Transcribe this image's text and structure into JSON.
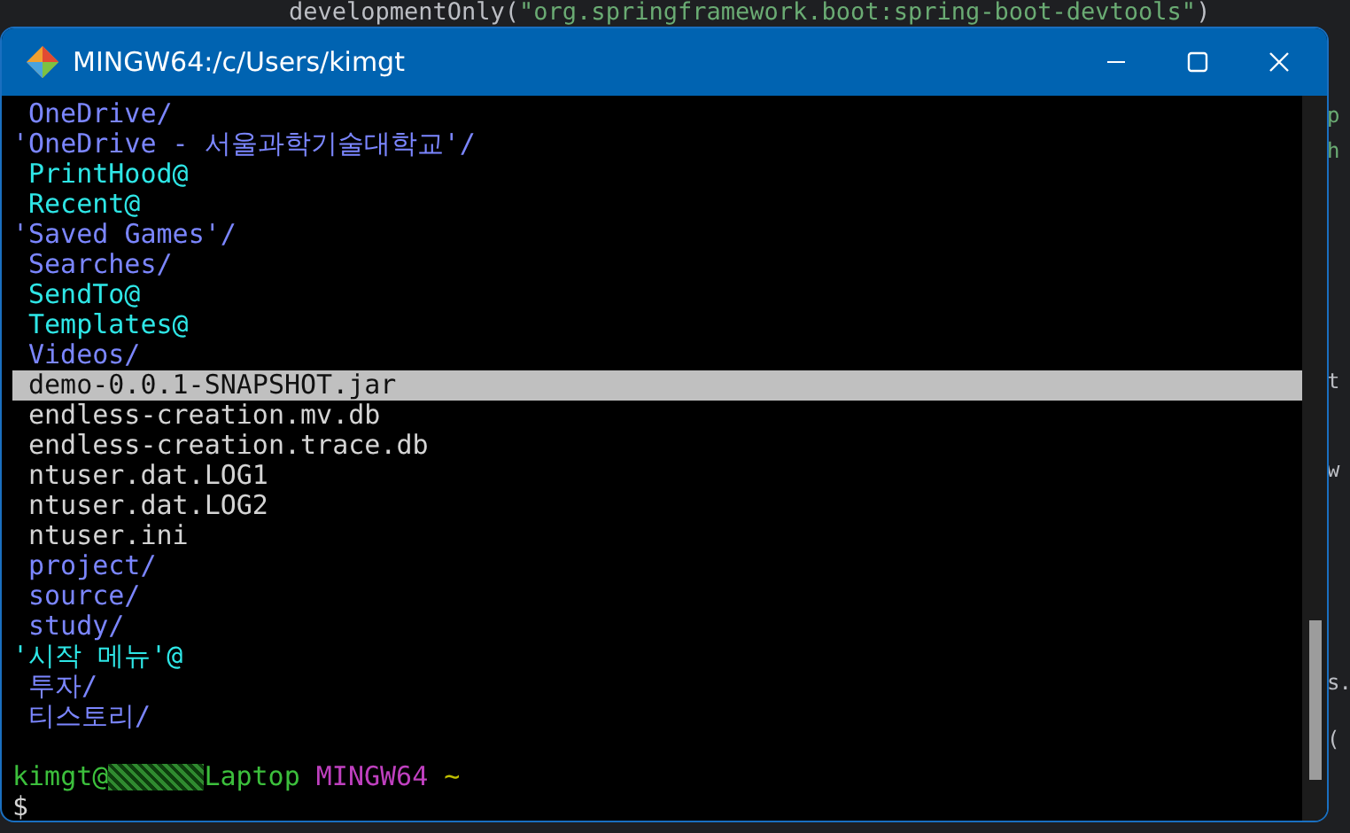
{
  "editor": {
    "top_line": [
      {
        "text": "developmentOnly(",
        "kind": "code"
      },
      {
        "text": "\"org.springframework.boot:spring-boot-devtools\"",
        "kind": "string"
      },
      {
        "text": ")",
        "kind": "code"
      }
    ],
    "edge_fragments": [
      {
        "text": "p",
        "kind": "string"
      },
      {
        "text": "h",
        "kind": "string"
      },
      {
        "text": "t",
        "kind": "code"
      },
      {
        "text": "w",
        "kind": "code"
      },
      {
        "text": "s.",
        "kind": "code"
      },
      {
        "text": "(",
        "kind": "code"
      }
    ]
  },
  "window": {
    "title": "MINGW64:/c/Users/kimgt"
  },
  "listing": [
    {
      "text": "OneDrive/",
      "kind": "dir",
      "quoted": false,
      "selected": false
    },
    {
      "text": "'OneDrive - 서울과학기술대학교'/",
      "kind": "dir",
      "quoted": true,
      "selected": false
    },
    {
      "text": "PrintHood@",
      "kind": "link",
      "quoted": false,
      "selected": false
    },
    {
      "text": "Recent@",
      "kind": "link",
      "quoted": false,
      "selected": false
    },
    {
      "text": "'Saved Games'/",
      "kind": "dir",
      "quoted": true,
      "selected": false
    },
    {
      "text": "Searches/",
      "kind": "dir",
      "quoted": false,
      "selected": false
    },
    {
      "text": "SendTo@",
      "kind": "link",
      "quoted": false,
      "selected": false
    },
    {
      "text": "Templates@",
      "kind": "link",
      "quoted": false,
      "selected": false
    },
    {
      "text": "Videos/",
      "kind": "dir",
      "quoted": false,
      "selected": false
    },
    {
      "text": "demo-0.0.1-SNAPSHOT.jar",
      "kind": "file",
      "quoted": false,
      "selected": true
    },
    {
      "text": "endless-creation.mv.db",
      "kind": "file",
      "quoted": false,
      "selected": false
    },
    {
      "text": "endless-creation.trace.db",
      "kind": "file",
      "quoted": false,
      "selected": false
    },
    {
      "text": "ntuser.dat.LOG1",
      "kind": "file",
      "quoted": false,
      "selected": false
    },
    {
      "text": "ntuser.dat.LOG2",
      "kind": "file",
      "quoted": false,
      "selected": false
    },
    {
      "text": "ntuser.ini",
      "kind": "file",
      "quoted": false,
      "selected": false
    },
    {
      "text": "project/",
      "kind": "dir",
      "quoted": false,
      "selected": false
    },
    {
      "text": "source/",
      "kind": "dir",
      "quoted": false,
      "selected": false
    },
    {
      "text": "study/",
      "kind": "dir",
      "quoted": false,
      "selected": false
    },
    {
      "text": "'시작 메뉴'@",
      "kind": "link",
      "quoted": true,
      "selected": false
    },
    {
      "text": "투자/",
      "kind": "dir",
      "quoted": false,
      "selected": false
    },
    {
      "text": "티스토리/",
      "kind": "dir",
      "quoted": false,
      "selected": false
    }
  ],
  "prompt": {
    "user": "kimgt@",
    "host": "Laptop",
    "system": "MINGW64",
    "path": "~",
    "symbol": "$"
  }
}
